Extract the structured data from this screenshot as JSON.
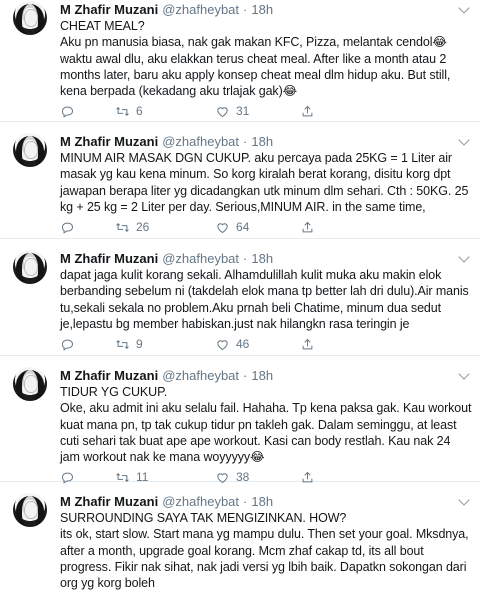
{
  "tweets": [
    {
      "name": "M Zhafir Muzani",
      "handle": "@zhafheybat",
      "time": "18h",
      "text": "CHEAT MEAL?\nAku pn manusia biasa, nak gak makan KFC, Pizza, melantak cendol😂 waktu awal dlu, aku elakkan terus cheat meal. After like a month atau 2 months later, baru aku apply konsep cheat meal dlm hidup aku. But still, kena berpada (kekadang aku trlajak gak)😂",
      "replies": "",
      "retweets": "6",
      "likes": "31"
    },
    {
      "name": "M Zhafir Muzani",
      "handle": "@zhafheybat",
      "time": "18h",
      "text": "MINUM AIR MASAK DGN CUKUP. aku percaya pada 25KG = 1 Liter air masak yg kau kena minum. So korg kiralah berat korang, disitu korg dpt jawapan berapa liter yg dicadangkan utk minum dlm sehari. Cth : 50KG. 25 kg + 25 kg = 2 Liter per day. Serious,MINUM AIR. in the same time,",
      "replies": "",
      "retweets": "26",
      "likes": "64"
    },
    {
      "name": "M Zhafir Muzani",
      "handle": "@zhafheybat",
      "time": "18h",
      "text": "dapat jaga kulit korang sekali. Alhamdulillah kulit muka aku makin elok berbanding sebelum ni (takdelah elok mana tp better lah dri dulu).Air manis tu,sekali sekala no problem.Aku prnah beli Chatime, minum dua sedut je,lepastu bg member habiskan.just nak hilangkn rasa teringin je",
      "replies": "",
      "retweets": "9",
      "likes": "46"
    },
    {
      "name": "M Zhafir Muzani",
      "handle": "@zhafheybat",
      "time": "18h",
      "text": "TIDUR YG CUKUP.\nOke, aku admit ini aku selalu fail. Hahaha. Tp kena paksa gak. Kau workout kuat mana pn, tp tak cukup tidur pn takleh gak. Dalam seminggu, at least cuti sehari tak buat ape ape workout. Kasi can body restlah. Kau nak 24 jam workout nak ke mana woyyyyy😂",
      "replies": "",
      "retweets": "11",
      "likes": "38"
    },
    {
      "name": "M Zhafir Muzani",
      "handle": "@zhafheybat",
      "time": "18h",
      "text": "SURROUNDING SAYA TAK MENGIZINKAN. HOW?\nits ok, start slow. Start mana yg mampu dulu. Then set your goal. Mksdnya, after a month, upgrade goal korang. Mcm zhaf cakap td, its all bout progress. Fikir nak sihat, nak jadi versi yg lbih baik. Dapatkn sokongan dari org yg korg boleh",
      "replies": "",
      "retweets": "",
      "likes": ""
    }
  ],
  "icons": {
    "avatar": "profile-photo",
    "caret": "chevron-down-icon",
    "reply": "reply-icon",
    "retweet": "retweet-icon",
    "like": "heart-icon",
    "share": "share-icon"
  },
  "colors": {
    "text": "#14171a",
    "muted": "#657786",
    "divider": "#e6ecf0"
  }
}
